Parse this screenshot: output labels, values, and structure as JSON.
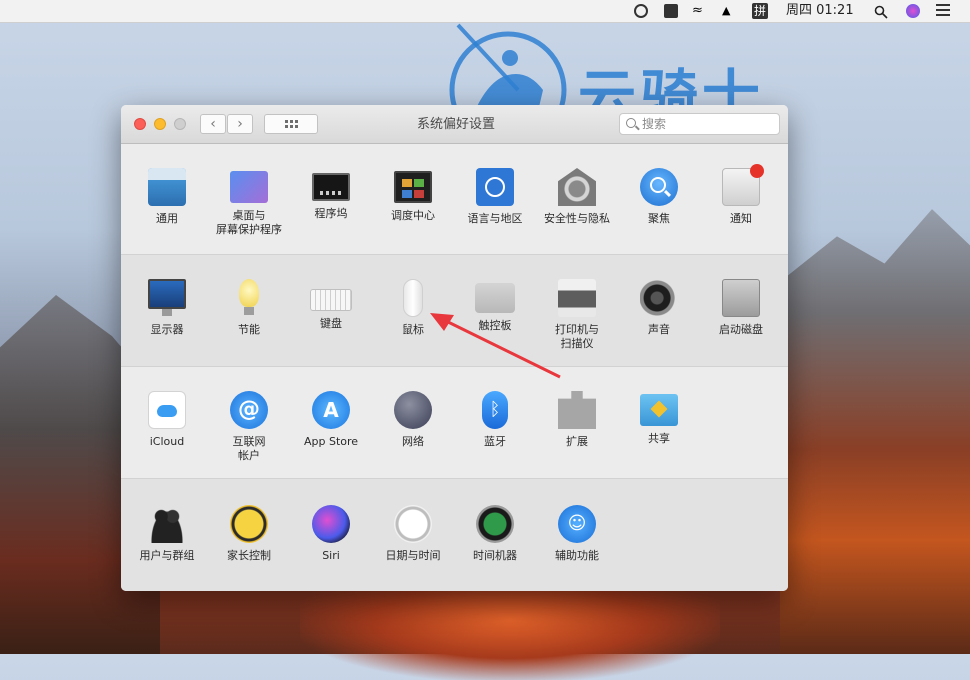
{
  "menubar": {
    "datetime": "周四 01:21",
    "input_method": "拼"
  },
  "watermark": {
    "text": "云骑士"
  },
  "window": {
    "title": "系统偏好设置",
    "search_placeholder": "搜索",
    "nav_back": "‹",
    "nav_forward": "›"
  },
  "sections": {
    "row1": [
      {
        "label": "通用",
        "icon": "general-icon"
      },
      {
        "label": "桌面与\n屏幕保护程序",
        "icon": "desktop-screensaver-icon"
      },
      {
        "label": "程序坞",
        "icon": "dock-icon"
      },
      {
        "label": "调度中心",
        "icon": "mission-control-icon"
      },
      {
        "label": "语言与地区",
        "icon": "language-region-icon"
      },
      {
        "label": "安全性与隐私",
        "icon": "security-privacy-icon"
      },
      {
        "label": "聚焦",
        "icon": "spotlight-icon"
      },
      {
        "label": "通知",
        "icon": "notifications-icon"
      }
    ],
    "row2": [
      {
        "label": "显示器",
        "icon": "displays-icon"
      },
      {
        "label": "节能",
        "icon": "energy-saver-icon"
      },
      {
        "label": "键盘",
        "icon": "keyboard-icon"
      },
      {
        "label": "鼠标",
        "icon": "mouse-icon"
      },
      {
        "label": "触控板",
        "icon": "trackpad-icon"
      },
      {
        "label": "打印机与\n扫描仪",
        "icon": "printers-scanners-icon"
      },
      {
        "label": "声音",
        "icon": "sound-icon"
      },
      {
        "label": "启动磁盘",
        "icon": "startup-disk-icon"
      }
    ],
    "row3": [
      {
        "label": "iCloud",
        "icon": "icloud-icon"
      },
      {
        "label": "互联网\n帐户",
        "icon": "internet-accounts-icon"
      },
      {
        "label": "App Store",
        "icon": "app-store-icon"
      },
      {
        "label": "网络",
        "icon": "network-icon"
      },
      {
        "label": "蓝牙",
        "icon": "bluetooth-icon"
      },
      {
        "label": "扩展",
        "icon": "extensions-icon"
      },
      {
        "label": "共享",
        "icon": "sharing-icon"
      }
    ],
    "row4": [
      {
        "label": "用户与群组",
        "icon": "users-groups-icon"
      },
      {
        "label": "家长控制",
        "icon": "parental-controls-icon"
      },
      {
        "label": "Siri",
        "icon": "siri-icon"
      },
      {
        "label": "日期与时间",
        "icon": "date-time-icon"
      },
      {
        "label": "时间机器",
        "icon": "time-machine-icon"
      },
      {
        "label": "辅助功能",
        "icon": "accessibility-icon"
      }
    ]
  },
  "colors": {
    "annotation_arrow": "#e8383d",
    "watermark": "#2f80d2"
  }
}
